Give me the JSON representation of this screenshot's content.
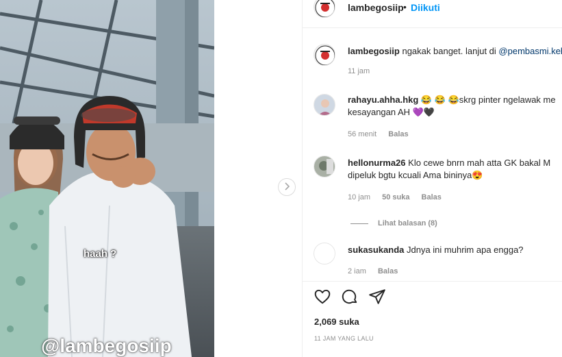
{
  "post": {
    "watermark": "@lambegosiip",
    "overlay_caption": "haah ?"
  },
  "header": {
    "username": "lambegosiip",
    "separator": "•",
    "follow_label": "Diikuti"
  },
  "caption": {
    "username": "lambegosiip",
    "text": " ngakak banget. lanjut di ",
    "mention": "@pembasmi.kehaluan",
    "time": "11 jam"
  },
  "comments": [
    {
      "username": "rahayu.ahha.hkg",
      "line1": " 😂 😂 😂skrg pinter ngelawak me",
      "line2": "kesayangan AH 💜🖤",
      "time": "56 menit",
      "likes": "",
      "reply_label": "Balas"
    },
    {
      "username": "hellonurma26",
      "line1": " Klo cewe bnrn mah atta GK bakal M",
      "line2": "dipeluk bgtu kcuali Ama bininya😍",
      "time": "10 jam",
      "likes": "50 suka",
      "reply_label": "Balas",
      "view_replies": "Lihat balasan (8)"
    },
    {
      "username": "sukasukanda",
      "line1": " Jdnya ini muhrim apa engga?",
      "line2": "",
      "time": "2 iam",
      "likes": "",
      "reply_label": "Balas"
    }
  ],
  "stats": {
    "likes": "2,069 suka",
    "posted": "11 JAM YANG LALU"
  },
  "icons": {
    "next": "chevron-right-icon",
    "like": "heart-icon",
    "comment": "comment-icon",
    "share": "send-icon"
  },
  "colors": {
    "follow": "#0095f6",
    "muted": "#8e8e8e",
    "text": "#262626"
  }
}
